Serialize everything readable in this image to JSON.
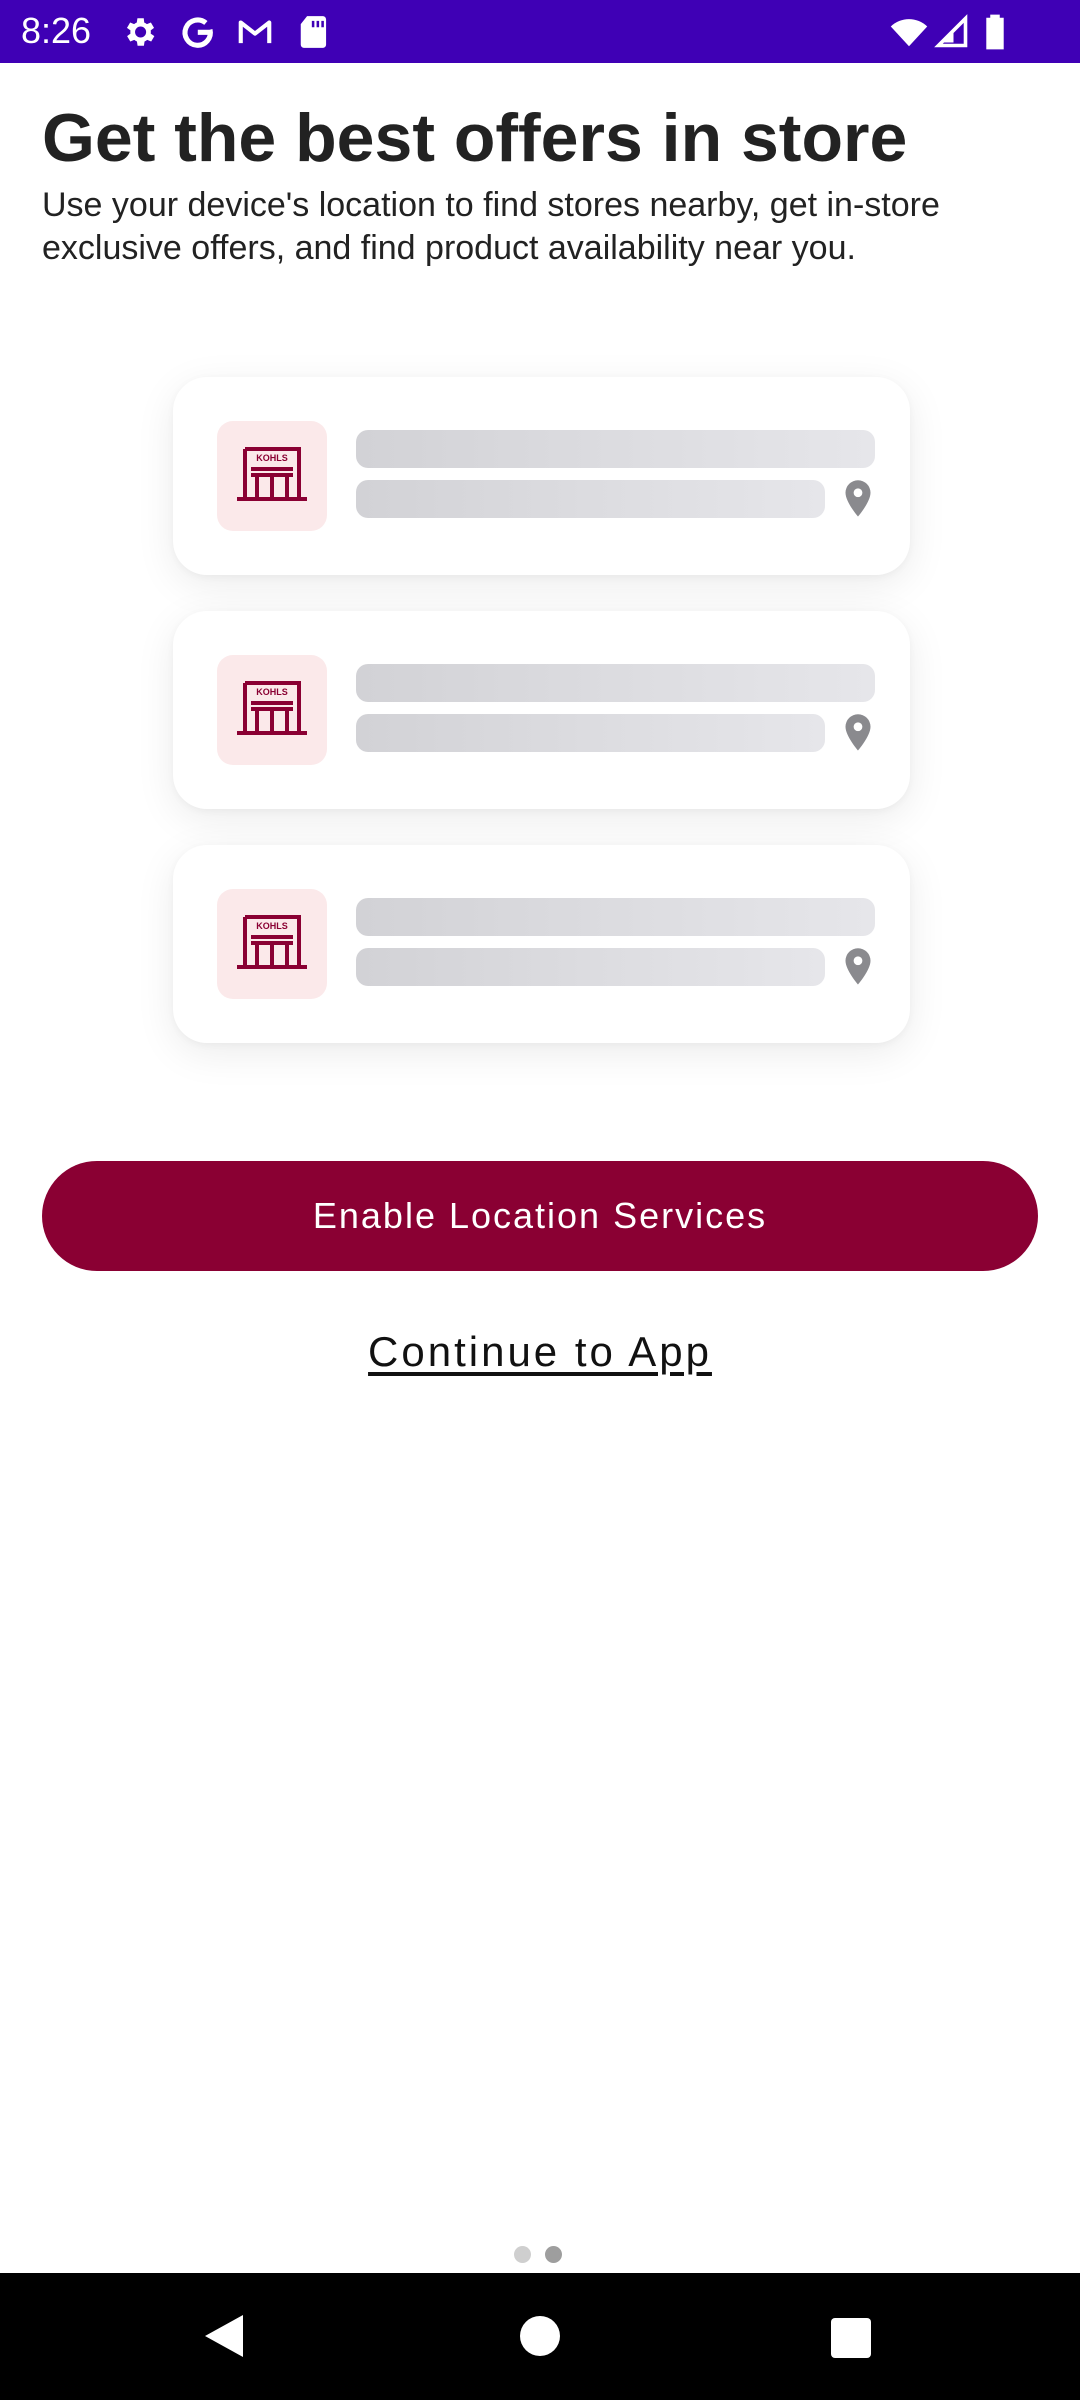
{
  "status_bar": {
    "time": "8:26",
    "left_icons": [
      "settings-icon",
      "google-icon",
      "gmail-icon",
      "sd-card-icon"
    ],
    "right_icons": [
      "wifi-icon",
      "signal-icon",
      "battery-icon"
    ],
    "background_color": "#3f00b5"
  },
  "header": {
    "title": "Get the best offers in store",
    "subtitle": "Use your device's location to find stores nearby, get in-store exclusive offers, and find product availability near you."
  },
  "store_cards": [
    {
      "thumb_text": "KOHLS",
      "icon": "store-icon",
      "pin": "location-pin-icon"
    },
    {
      "thumb_text": "KOHLS",
      "icon": "store-icon",
      "pin": "location-pin-icon"
    },
    {
      "thumb_text": "KOHLS",
      "icon": "store-icon",
      "pin": "location-pin-icon"
    }
  ],
  "actions": {
    "enable_location_label": "Enable Location Services",
    "continue_label": "Continue to App"
  },
  "pager": {
    "total_pages": 2,
    "current_page": 2
  },
  "colors": {
    "accent": "#8a0033",
    "thumb_bg": "#fbe9ea",
    "skeleton": "#d2d2d6"
  }
}
